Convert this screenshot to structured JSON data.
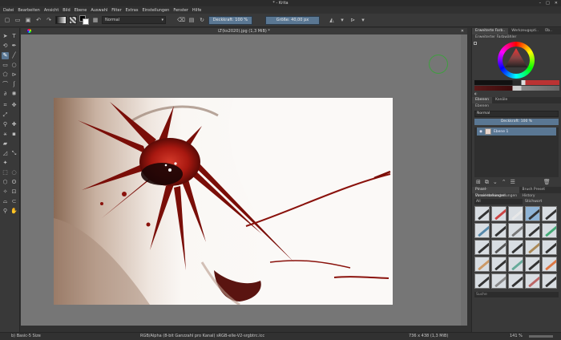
{
  "window": {
    "title": "* - Krita"
  },
  "menu": [
    "Datei",
    "Bearbeiten",
    "Ansicht",
    "Bild",
    "Ebene",
    "Auswahl",
    "Filter",
    "Extras",
    "Einstellungen",
    "Fenster",
    "Hilfe"
  ],
  "toolbar": {
    "blend_mode": "Normal",
    "opacity_label": "Deckkraft: 100 %",
    "size_label": "Größe: 40,00 px"
  },
  "document": {
    "tab_title": "LT(ks2020).jpg (1,3 MiB) *"
  },
  "dock": {
    "top_tabs": [
      "Erweiterte Farb..",
      "Werkzeugopti..",
      "Üb.."
    ],
    "color_selector_title": "Erweiterter Farbwähler",
    "layer_tabs": [
      "Ebenen",
      "Kanäle"
    ],
    "layers_title": "Ebenen",
    "layer_blend": "Normal",
    "layer_opacity": "Deckkraft: 100 %",
    "layer_name": "Ebene 1",
    "preset_tabs": [
      "Pinsel-Voreinstellungen",
      "Brush Preset History"
    ],
    "presets_title": "Pinsel-Voreinstellungen",
    "preset_filter": "All",
    "tag_label": "Stichwort",
    "search_placeholder": "Suche"
  },
  "status": {
    "brush": "b) Basic-5 Size",
    "color_space": "RGB/Alpha (8-bit Ganzzahl pro Kanal)  sRGB-elle-V2-srgbtrc.icc",
    "image_size": "736 x 438 (1,3 MiB)",
    "zoom": "141 %"
  }
}
